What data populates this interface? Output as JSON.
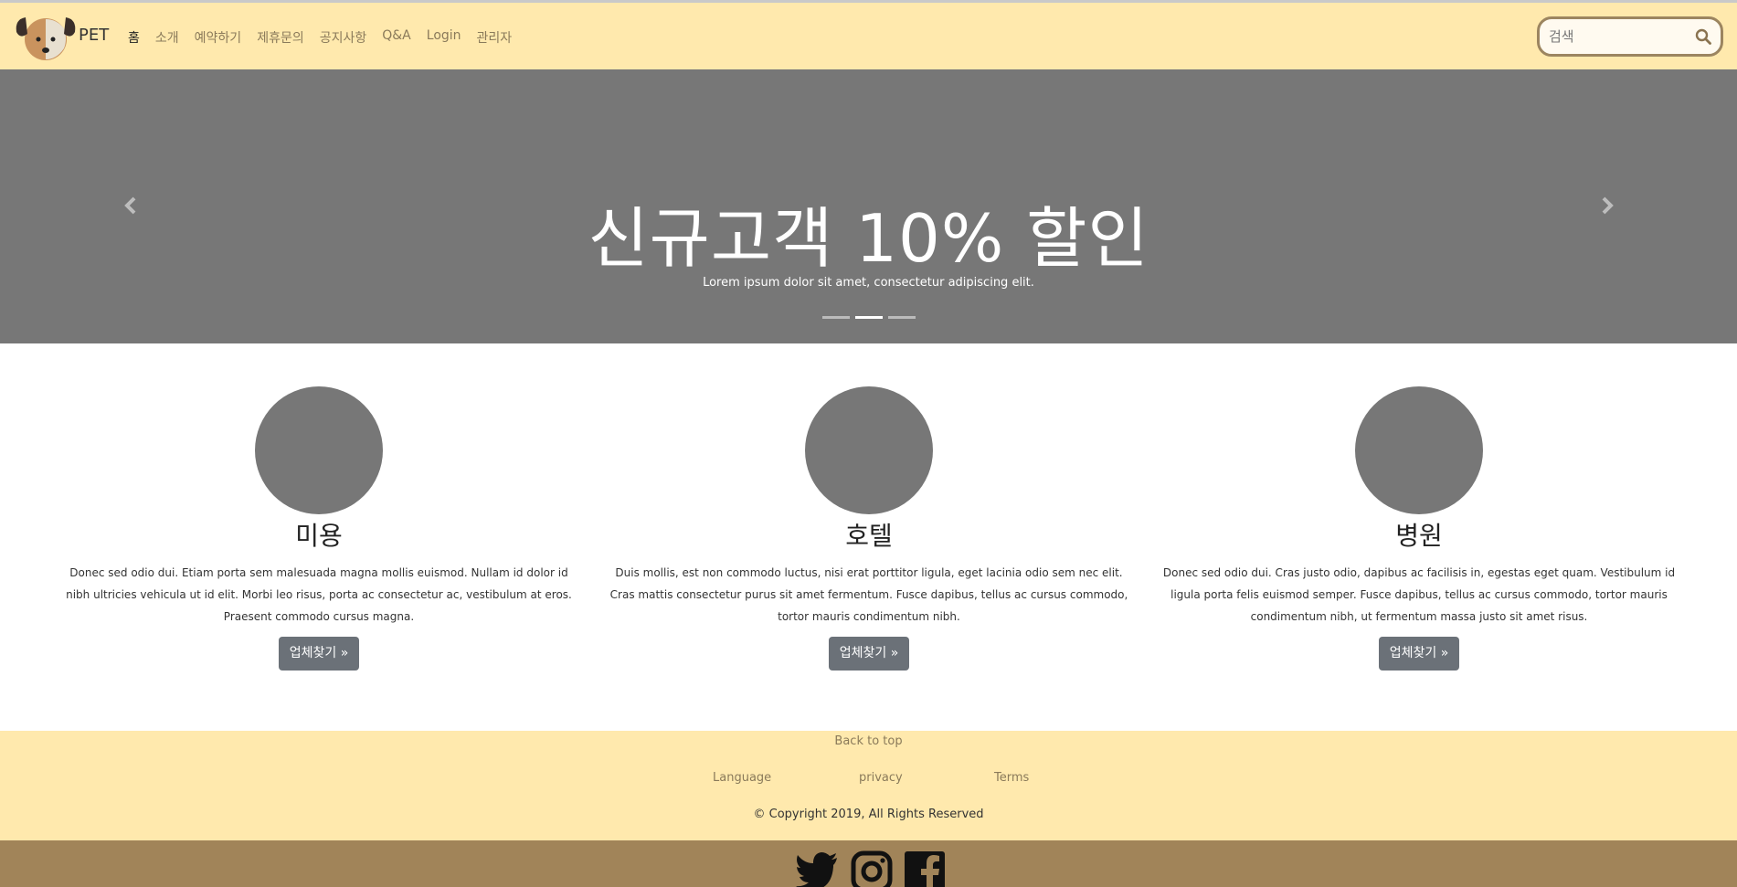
{
  "brand": {
    "name": "PET",
    "logo_icon": "dog-face-icon"
  },
  "nav": {
    "items": [
      {
        "label": "홈",
        "active": true
      },
      {
        "label": "소개"
      },
      {
        "label": "예약하기"
      },
      {
        "label": "제휴문의"
      },
      {
        "label": "공지사항"
      },
      {
        "label": "Q&A"
      },
      {
        "label": "Login"
      },
      {
        "label": "관리자"
      }
    ]
  },
  "search": {
    "placeholder": "검색",
    "value": "",
    "icon": "search-icon"
  },
  "carousel": {
    "title": "신규고객 10% 할인",
    "subtitle": "Lorem ipsum dolor sit amet, consectetur adipiscing elit.",
    "slide_count": 3,
    "active_slide": 2
  },
  "features": [
    {
      "title": "미용",
      "text": "Donec sed odio dui. Etiam porta sem malesuada magna mollis euismod. Nullam id dolor id nibh ultricies vehicula ut id elit. Morbi leo risus, porta ac consectetur ac, vestibulum at eros. Praesent commodo cursus magna.",
      "button": "업체찾기 »"
    },
    {
      "title": "호텔",
      "text": "Duis mollis, est non commodo luctus, nisi erat porttitor ligula, eget lacinia odio sem nec elit. Cras mattis consectetur purus sit amet fermentum. Fusce dapibus, tellus ac cursus commodo, tortor mauris condimentum nibh.",
      "button": "업체찾기 »"
    },
    {
      "title": "병원",
      "text": "Donec sed odio dui. Cras justo odio, dapibus ac facilisis in, egestas eget quam. Vestibulum id ligula porta felis euismod semper. Fusce dapibus, tellus ac cursus commodo, tortor mauris condimentum nibh, ut fermentum massa justo sit amet risus.",
      "button": "업체찾기 »"
    }
  ],
  "footer": {
    "back_to_top": "Back to top",
    "links": [
      "Language",
      "privacy",
      "Terms"
    ],
    "copyright": "© Copyright 2019, All Rights Reserved",
    "social_icons": [
      "twitter-icon",
      "instagram-icon",
      "facebook-icon"
    ]
  },
  "colors": {
    "nav_bg": "#ffe9ad",
    "carousel_bg": "#777777",
    "button_bg": "#6b7178",
    "social_bar_bg": "#a18459",
    "search_border": "#9c8560"
  }
}
